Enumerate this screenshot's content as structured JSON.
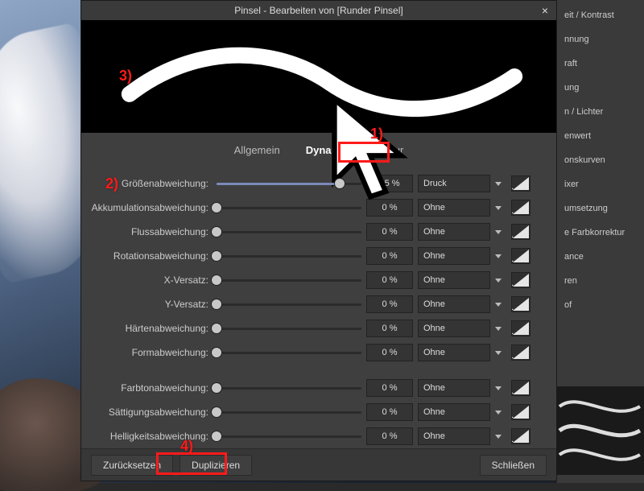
{
  "dialog": {
    "title": "Pinsel - Bearbeiten von [Runder Pinsel]"
  },
  "tabs": {
    "general": "Allgemein",
    "dynamik": "Dynamik",
    "textur": "Textur"
  },
  "rows": [
    {
      "label": "Größenabweichung:",
      "value": "85 %",
      "source": "Druck",
      "pct": 85
    },
    {
      "label": "Akkumulationsabweichung:",
      "value": "0 %",
      "source": "Ohne",
      "pct": 0
    },
    {
      "label": "Flussabweichung:",
      "value": "0 %",
      "source": "Ohne",
      "pct": 0
    },
    {
      "label": "Rotationsabweichung:",
      "value": "0 %",
      "source": "Ohne",
      "pct": 0
    },
    {
      "label": "X-Versatz:",
      "value": "0 %",
      "source": "Ohne",
      "pct": 0
    },
    {
      "label": "Y-Versatz:",
      "value": "0 %",
      "source": "Ohne",
      "pct": 0
    },
    {
      "label": "Härtenabweichung:",
      "value": "0 %",
      "source": "Ohne",
      "pct": 0
    },
    {
      "label": "Formabweichung:",
      "value": "0 %",
      "source": "Ohne",
      "pct": 0
    }
  ],
  "rows2": [
    {
      "label": "Farbtonabweichung:",
      "value": "0 %",
      "source": "Ohne",
      "pct": 0
    },
    {
      "label": "Sättigungsabweichung:",
      "value": "0 %",
      "source": "Ohne",
      "pct": 0
    },
    {
      "label": "Helligkeitsabweichung:",
      "value": "0 %",
      "source": "Ohne",
      "pct": 0
    }
  ],
  "footer": {
    "reset": "Zurücksetzen",
    "duplicate": "Duplizieren",
    "close": "Schließen"
  },
  "annotations": {
    "a1": "1)",
    "a2": "2)",
    "a3": "3)",
    "a4": "4)"
  },
  "side_panel": {
    "items": [
      "eit / Kontrast",
      "nnung",
      "raft",
      "ung",
      "n / Lichter",
      "enwert",
      "onskurven",
      "ixer",
      "umsetzung",
      "e Farbkorrektur",
      "ance",
      "ren",
      "of"
    ]
  }
}
